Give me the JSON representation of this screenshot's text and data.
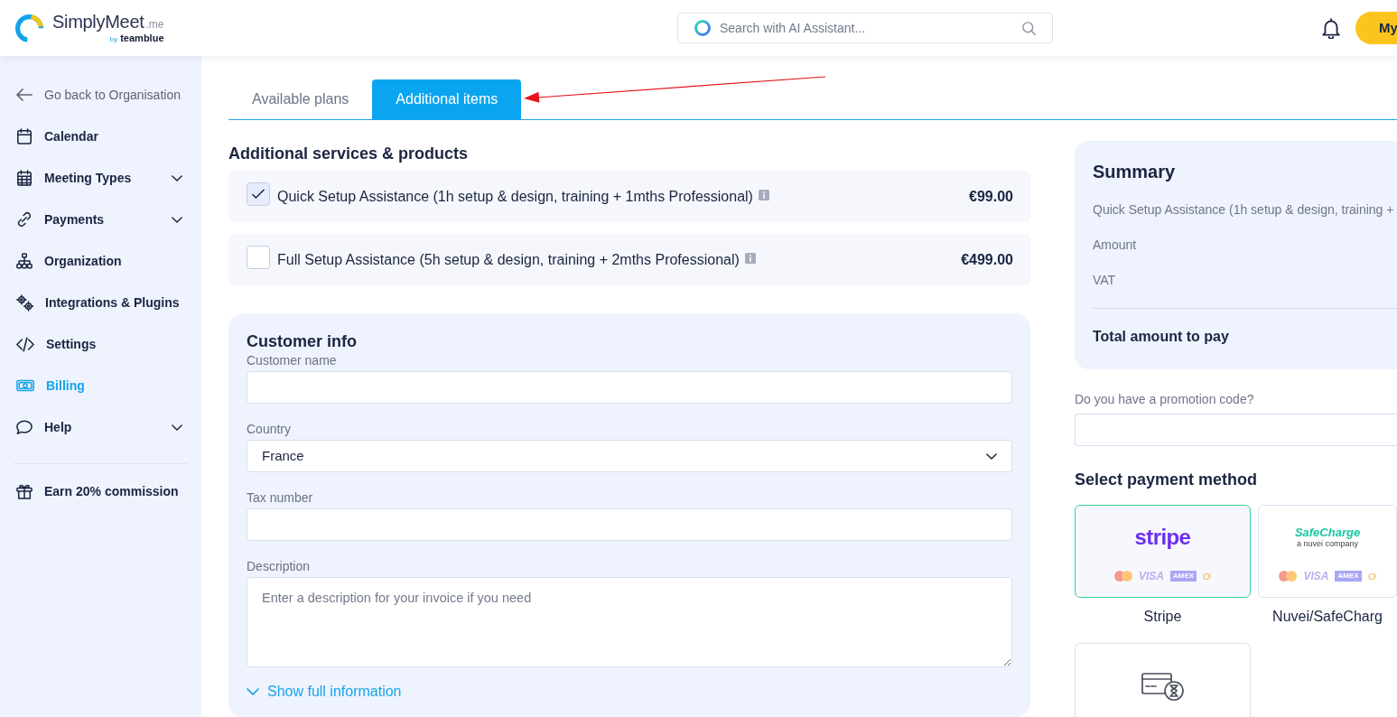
{
  "header": {
    "brand": {
      "name": "SimplyMeet",
      "suffix": ".me",
      "byline": "by",
      "company": "teamblue"
    },
    "search": {
      "placeholder": "Search with AI Assistant..."
    },
    "account_button": {
      "label": "My"
    }
  },
  "sidebar": {
    "items": [
      {
        "label": "Go back to Organisation",
        "kind": "back",
        "selected": false
      },
      {
        "label": "Calendar",
        "kind": "link",
        "selected": false
      },
      {
        "label": "Meeting Types",
        "kind": "group",
        "selected": false
      },
      {
        "label": "Payments",
        "kind": "group",
        "selected": false
      },
      {
        "label": "Organization",
        "kind": "link",
        "selected": false
      },
      {
        "label": "Integrations & Plugins",
        "kind": "link",
        "selected": false
      },
      {
        "label": "Settings",
        "kind": "link",
        "selected": false
      },
      {
        "label": "Billing",
        "kind": "link",
        "selected": true
      },
      {
        "label": "Help",
        "kind": "group",
        "selected": false
      }
    ],
    "footer_item": {
      "label": "Earn 20% commission"
    }
  },
  "tabs": [
    {
      "label": "Available plans",
      "selected": false
    },
    {
      "label": "Additional items",
      "selected": true
    }
  ],
  "services": {
    "title": "Additional services & products",
    "items": [
      {
        "label": "Quick Setup Assistance (1h setup & design, training + 1mths Professional)",
        "price": "€99.00",
        "checked": true
      },
      {
        "label": "Full Setup Assistance (5h setup & design, training + 2mths Professional)",
        "price": "€499.00",
        "checked": false
      }
    ]
  },
  "customer_info": {
    "title": "Customer info",
    "fields": [
      {
        "kind": "text",
        "label": "Customer name"
      },
      {
        "kind": "select",
        "label": "Country",
        "value": "France"
      },
      {
        "kind": "text",
        "label": "Tax number"
      },
      {
        "kind": "textarea",
        "label": "Description",
        "placeholder": "Enter a description for your invoice if you need"
      }
    ],
    "toggle": "Show full information"
  },
  "summary": {
    "title": "Summary",
    "lines": [
      "Quick Setup Assistance (1h setup & design, training +",
      "Amount",
      "VAT"
    ],
    "total_label": "Total amount to pay"
  },
  "promotion": {
    "label": "Do you have a promotion code?"
  },
  "payment": {
    "title": "Select payment method",
    "methods": [
      {
        "kind": "stripe",
        "logo": "stripe",
        "brands": [
          "VISA",
          "AMEX"
        ],
        "label": "Stripe",
        "selected": true
      },
      {
        "kind": "safecharge",
        "logo": "SafeCharge",
        "logo_caption": "a nuvei company",
        "brands": [
          "VISA",
          "AMEX"
        ],
        "label": "Nuvei/SafeCharg",
        "selected": false
      },
      {
        "kind": "pending",
        "selected": false
      }
    ]
  }
}
